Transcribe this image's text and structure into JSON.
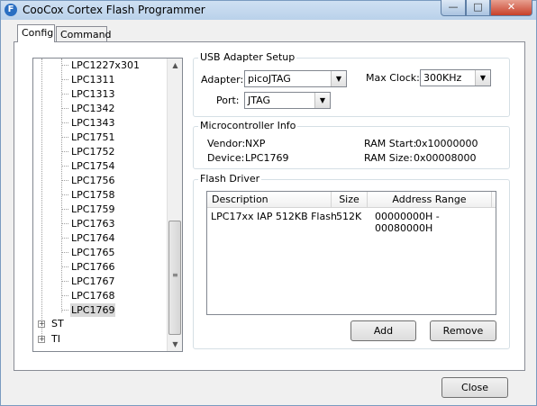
{
  "window": {
    "title": "CooCox Cortex Flash Programmer",
    "app_icon_letter": "F",
    "minimize_glyph": "—",
    "maximize_glyph": "□",
    "close_glyph": "✕"
  },
  "tabs": [
    {
      "label": "Config",
      "active": true
    },
    {
      "label": "Command",
      "active": false
    }
  ],
  "tree": {
    "items": [
      "LPC1227x301",
      "LPC1311",
      "LPC1313",
      "LPC1342",
      "LPC1343",
      "LPC1751",
      "LPC1752",
      "LPC1754",
      "LPC1756",
      "LPC1758",
      "LPC1759",
      "LPC1763",
      "LPC1764",
      "LPC1765",
      "LPC1766",
      "LPC1767",
      "LPC1768",
      "LPC1769"
    ],
    "selected": "LPC1769",
    "folders": [
      {
        "label": "ST",
        "expander": "+"
      },
      {
        "label": "TI",
        "expander": "+"
      }
    ],
    "scroll_up_glyph": "▲",
    "scroll_down_glyph": "▼",
    "grip_glyph": "≡"
  },
  "usb_adapter": {
    "legend": "USB Adapter Setup",
    "adapter_label": "Adapter:",
    "adapter_value": "picoJTAG",
    "max_clock_label": "Max Clock:",
    "max_clock_value": "300KHz",
    "port_label": "Port:",
    "port_value": "JTAG",
    "dropdown_glyph": "▼"
  },
  "mcu_info": {
    "legend": "Microcontroller Info",
    "vendor_label": "Vendor:",
    "vendor_value": "NXP",
    "device_label": "Device:",
    "device_value": "LPC1769",
    "ram_start_label": "RAM Start:",
    "ram_start_value": "0x10000000",
    "ram_size_label": "RAM Size:",
    "ram_size_value": "0x00008000"
  },
  "flash_driver": {
    "legend": "Flash Driver",
    "columns": [
      "Description",
      "Size",
      "Address Range"
    ],
    "rows": [
      {
        "description": "LPC17xx IAP 512KB Flash",
        "size": "512K",
        "address_range": "00000000H - 00080000H"
      }
    ],
    "add_label": "Add",
    "remove_label": "Remove"
  },
  "footer": {
    "close_label": "Close"
  },
  "colors": {
    "titlebar": "#b9d1ea",
    "close_button": "#c7402a",
    "panel_bg": "#f0f0f0",
    "selection": "#d9d9d9"
  }
}
